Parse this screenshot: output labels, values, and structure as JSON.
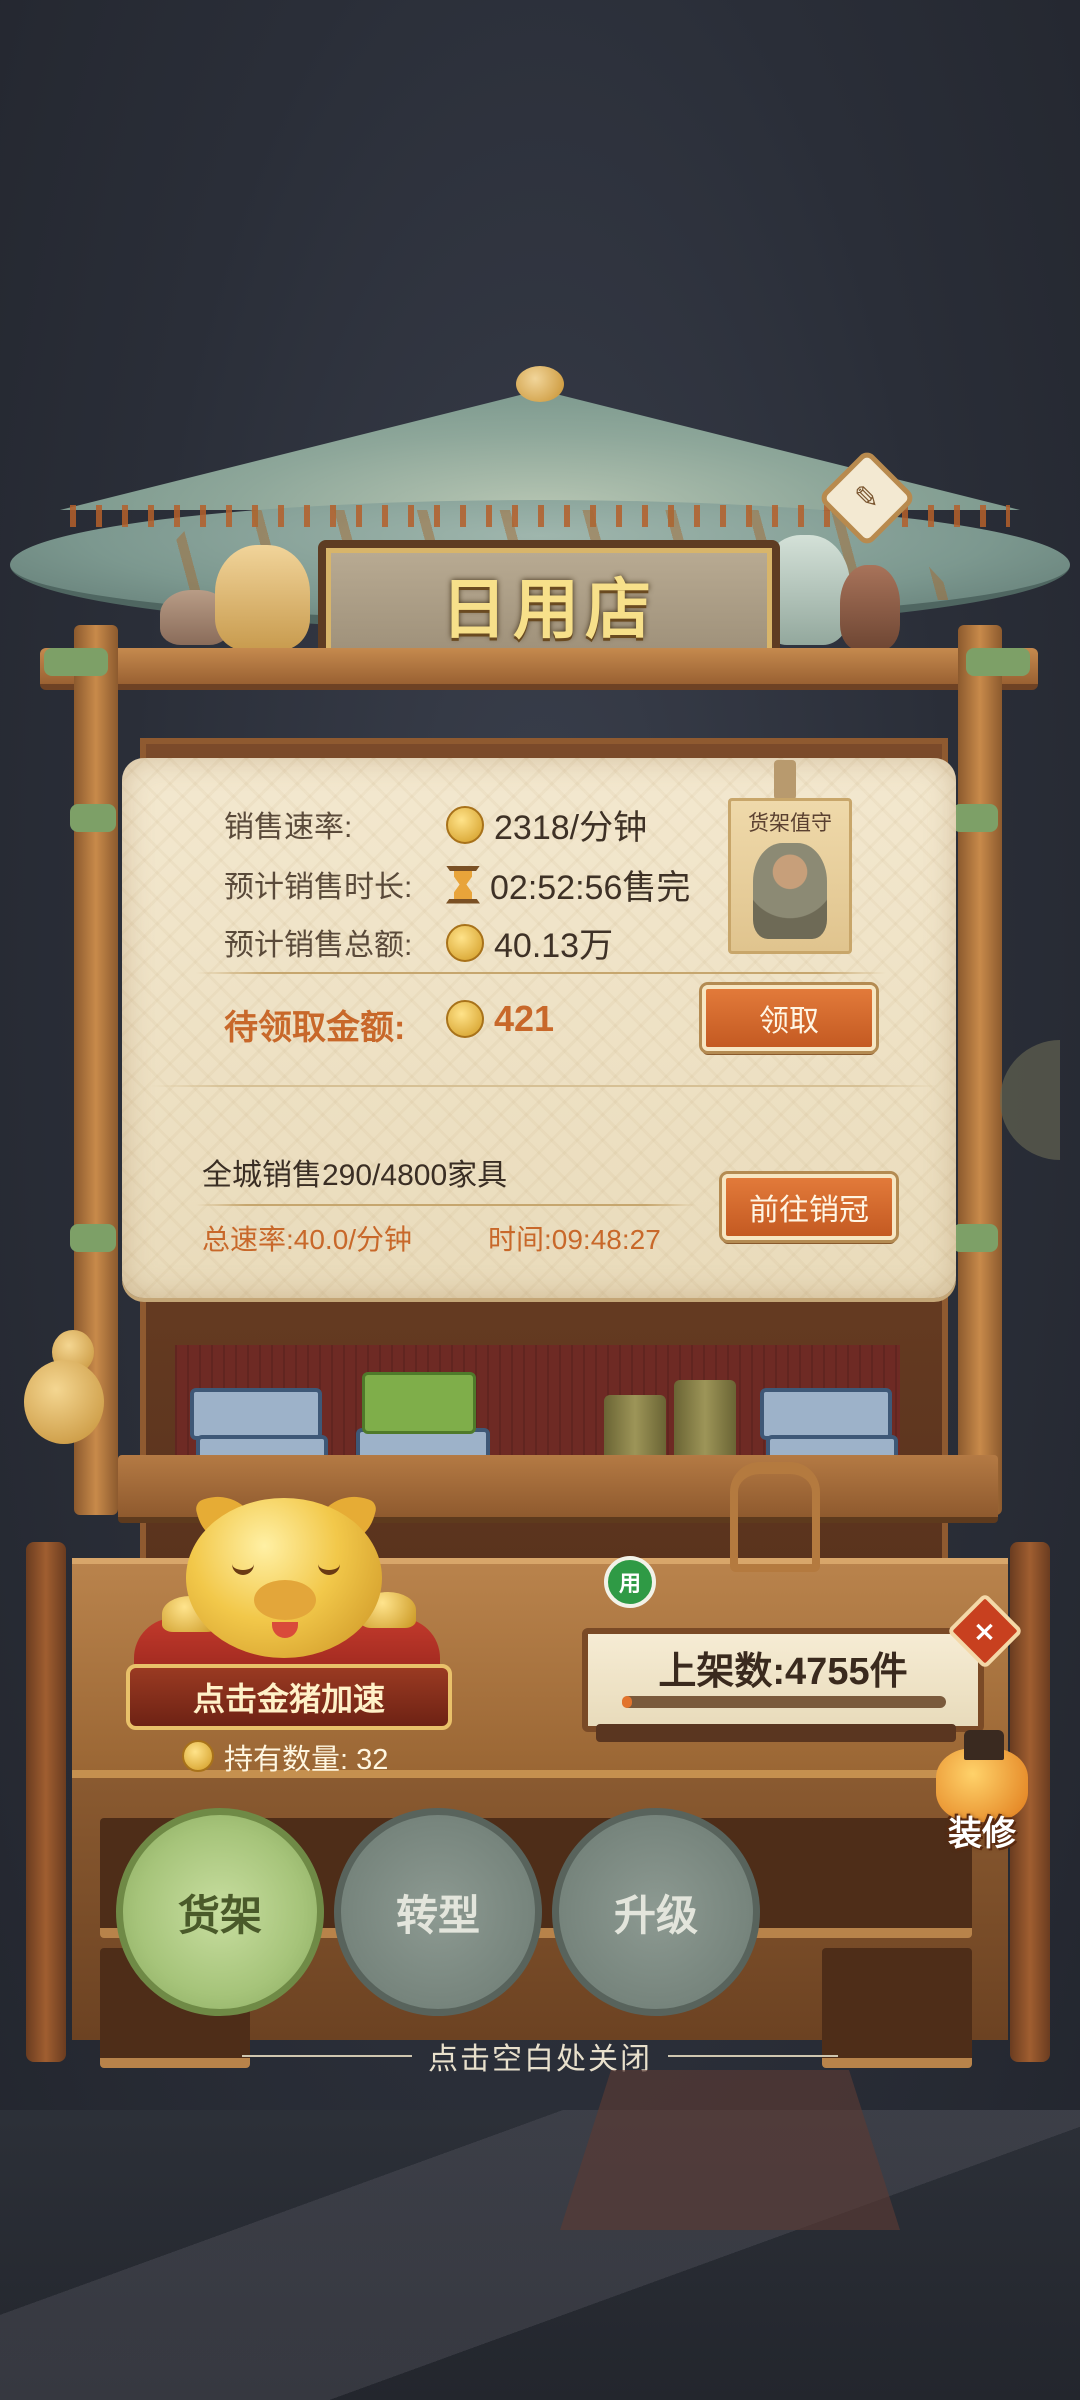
{
  "shop": {
    "title": "日用店"
  },
  "stats": {
    "sales_rate_label": "销售速率:",
    "sales_rate_value": "2318/分钟",
    "eta_label": "预计销售时长:",
    "eta_value": "02:52:56售完",
    "total_label": "预计销售总额:",
    "total_value": "40.13万",
    "pending_label": "待领取金额:",
    "pending_value": "421",
    "claim_button": "领取"
  },
  "guard": {
    "label": "货架值守"
  },
  "city": {
    "sales_text": "全城销售290/4800家具",
    "rate_text": "总速率:40.0/分钟",
    "time_text": "时间:09:48:27",
    "crown_button": "前往销冠"
  },
  "pig": {
    "boost_button": "点击金猪加速",
    "hold_text": "持有数量: 32"
  },
  "use_badge": "用",
  "shelf_count": {
    "text": "上架数:4755件",
    "progress": 0.03
  },
  "decorate_label": "装修",
  "close_symbol": "×",
  "tabs": {
    "shelf": "货架",
    "transform": "转型",
    "upgrade": "升级"
  },
  "close_hint": "点击空白处关闭",
  "icons": {
    "edit": "pencil-icon",
    "coin": "coin-icon",
    "hourglass": "hourglass-icon"
  },
  "colors": {
    "accent_orange": "#c8682a",
    "tab_active": "#a6c47a",
    "tab_inactive": "#76847c",
    "sign_text": "#f7e08a"
  }
}
